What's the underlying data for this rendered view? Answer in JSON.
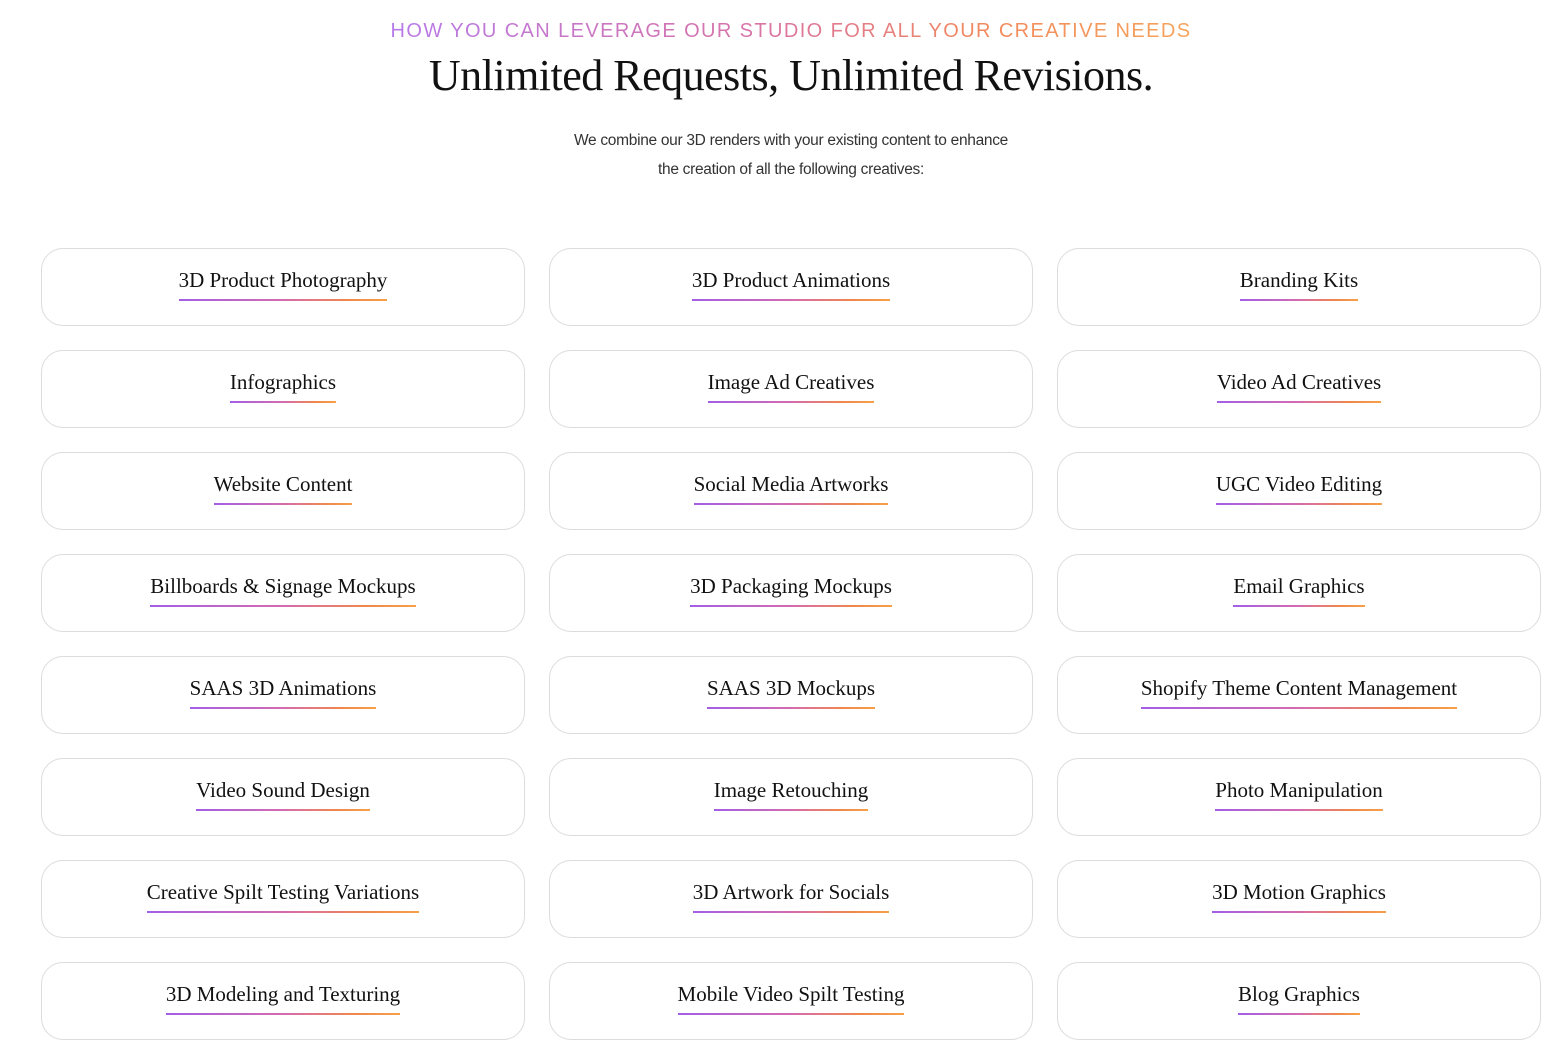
{
  "section": {
    "eyebrow": "HOW YOU CAN LEVERAGE OUR STUDIO FOR ALL YOUR CREATIVE NEEDS",
    "headline": "Unlimited Requests, Unlimited Revisions.",
    "subtext_line1": "We combine our 3D renders with your existing content to enhance",
    "subtext_line2": "the creation of all the following creatives:"
  },
  "colors": {
    "gradient_start": "#a35ee6",
    "gradient_mid": "#d46bb0",
    "gradient_end": "#f6a047",
    "card_border": "#dcdcdc",
    "text": "#111111"
  },
  "services": [
    "3D Product Photography",
    "3D Product Animations",
    "Branding Kits",
    "Infographics",
    "Image Ad Creatives",
    "Video Ad Creatives",
    "Website Content",
    "Social Media Artworks",
    "UGC Video Editing",
    "Billboards & Signage Mockups",
    "3D Packaging Mockups",
    "Email Graphics",
    "SAAS 3D Animations",
    "SAAS 3D Mockups",
    "Shopify Theme Content Management",
    "Video Sound Design",
    "Image Retouching",
    "Photo Manipulation",
    "Creative Spilt Testing Variations",
    "3D Artwork for Socials",
    "3D Motion Graphics",
    "3D Modeling and Texturing",
    "Mobile Video Spilt Testing",
    "Blog Graphics"
  ]
}
